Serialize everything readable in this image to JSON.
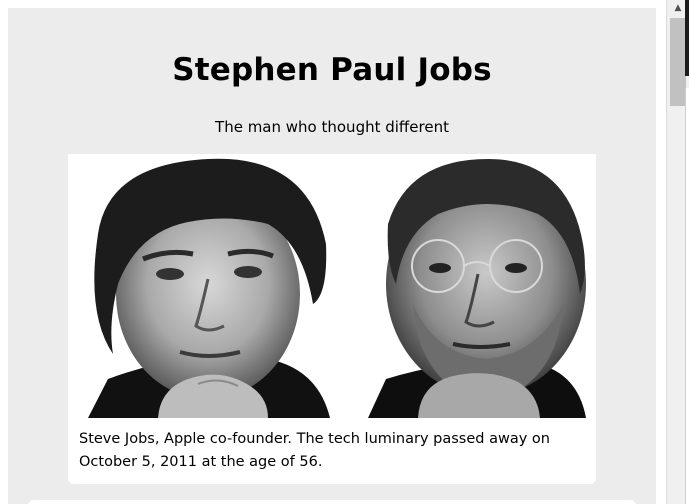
{
  "page": {
    "title": "Stephen Paul Jobs",
    "subtitle": "The man who thought different"
  },
  "figure": {
    "caption": "Steve Jobs, Apple co-founder. The tech luminary passed away on October 5, 2011 at the age of 56."
  },
  "scrollbar": {
    "up_arrow": "▲"
  }
}
